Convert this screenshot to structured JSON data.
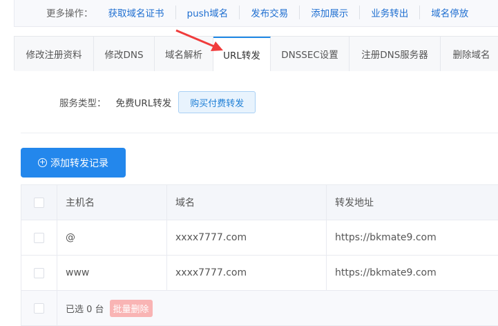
{
  "more_actions": {
    "label": "更多操作：",
    "links": [
      "获取域名证书",
      "push域名",
      "发布交易",
      "添加展示",
      "业务转出",
      "域名停放"
    ]
  },
  "tabs": [
    "修改注册资料",
    "修改DNS",
    "域名解析",
    "URL转发",
    "DNSSEC设置",
    "注册DNS服务器",
    "删除域名"
  ],
  "active_tab": "URL转发",
  "service": {
    "label": "服务类型：",
    "value": "免费URL转发",
    "buy_button": "购买付费转发"
  },
  "add_button": "添加转发记录",
  "table": {
    "headers": [
      "主机名",
      "域名",
      "转发地址"
    ],
    "rows": [
      [
        "@",
        "xxxx7777.com",
        "https://bkmate9.com"
      ],
      [
        "www",
        "xxxx7777.com",
        "https://bkmate9.com"
      ]
    ],
    "footer": {
      "selected": "已选 0 台",
      "bulk_delete": "批量删除"
    }
  },
  "colors": {
    "primary": "#2387ec",
    "annotation_arrow": "#f03c3c"
  }
}
